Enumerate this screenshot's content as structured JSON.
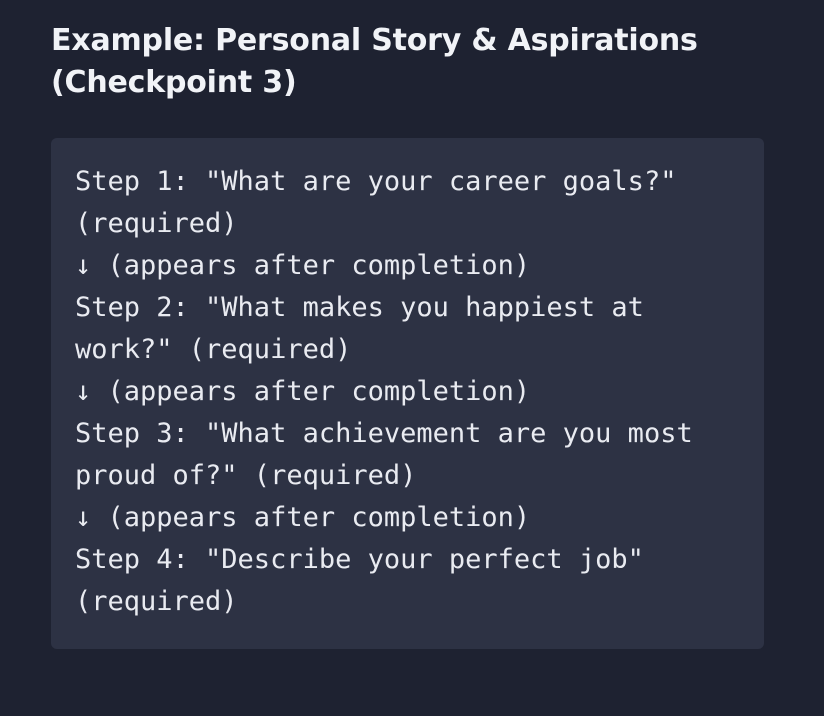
{
  "heading": {
    "line1": "Example: Personal Story & Aspirations",
    "line2": "(Checkpoint 3)"
  },
  "flow": {
    "lines": [
      "Step 1: \"What are your career goals?\"",
      "(required)",
      "↓ (appears after completion)",
      "Step 2: \"What makes you happiest at",
      "work?\" (required)",
      "↓ (appears after completion)",
      "Step 3: \"What achievement are you most",
      "proud of?\" (required)",
      "↓ (appears after completion)",
      "Step 4: \"Describe your perfect job\"",
      "(required)"
    ]
  }
}
